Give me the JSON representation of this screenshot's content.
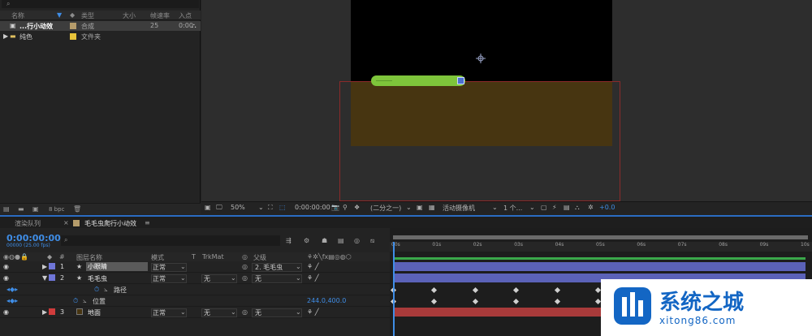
{
  "project": {
    "headers": {
      "name": "名称",
      "type": "类型",
      "size": "大小",
      "fps": "帧速率",
      "in": "入点"
    },
    "items": [
      {
        "name": "...行小动效",
        "type": "合成",
        "fps": "25",
        "in": "0:00",
        "color": "#b59c6b"
      },
      {
        "name": "纯色",
        "type": "文件夹",
        "fps": "",
        "in": "",
        "color": "#e8c43a"
      }
    ],
    "bpc": "8 bpc"
  },
  "composition": {
    "zoom": "50%",
    "time": "0:00:00:00",
    "resolution": "(二分之一)",
    "camera": "活动摄像机",
    "views": "1 个...",
    "exposure": "+0.0"
  },
  "tabs": {
    "render_queue": "渲染队列",
    "comp_tab": "毛毛虫爬行小动效"
  },
  "timeline": {
    "timecode": "0:00:00:00",
    "timecode_sub": "00000 (25.00 fps)",
    "columns": {
      "num": "#",
      "layer_name": "图层名称",
      "mode": "模式",
      "t": "T",
      "trkmat": "TrkMat",
      "parent": "父级"
    },
    "layers": [
      {
        "num": "1",
        "name": "小眼睛",
        "mode": "正常",
        "trkmat": "",
        "parent": "2. 毛毛虫",
        "color": "#6f76d8"
      },
      {
        "num": "2",
        "name": "毛毛虫",
        "mode": "正常",
        "trkmat": "无",
        "parent": "无",
        "color": "#6f76d8"
      },
      {
        "num": "3",
        "name": "地面",
        "mode": "正常",
        "trkmat": "无",
        "parent": "无",
        "color": "#d03c3c"
      }
    ],
    "props": {
      "path": "路径",
      "position": "位置",
      "position_value": "244.0,400.0"
    },
    "ruler": [
      "00s",
      "01s",
      "02s",
      "03s",
      "04s",
      "05s",
      "06s",
      "07s",
      "08s",
      "09s",
      "10s"
    ]
  },
  "watermark": {
    "title": "系统之城",
    "url": "xitong86.com"
  }
}
